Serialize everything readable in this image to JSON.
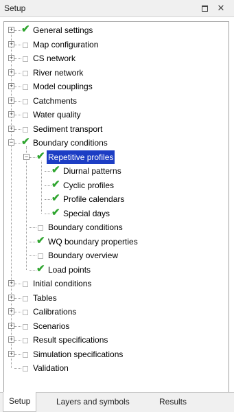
{
  "panel": {
    "title": "Setup"
  },
  "tree": [
    {
      "label": "General settings",
      "checked": true
    },
    {
      "label": "Map configuration",
      "checked": false
    },
    {
      "label": "CS network",
      "checked": false
    },
    {
      "label": "River network",
      "checked": false
    },
    {
      "label": "Model couplings",
      "checked": false
    },
    {
      "label": "Catchments",
      "checked": false
    },
    {
      "label": "Water quality",
      "checked": false
    },
    {
      "label": "Sediment transport",
      "checked": false
    },
    {
      "label": "Boundary conditions",
      "checked": true,
      "expanded": true
    },
    {
      "label": "Repetitive profiles",
      "checked": true,
      "expanded": true,
      "selected": true
    },
    {
      "label": "Diurnal patterns",
      "checked": true
    },
    {
      "label": "Cyclic profiles",
      "checked": true
    },
    {
      "label": "Profile calendars",
      "checked": true
    },
    {
      "label": "Special days",
      "checked": true
    },
    {
      "label": "Boundary conditions",
      "checked": false
    },
    {
      "label": "WQ boundary properties",
      "checked": true
    },
    {
      "label": "Boundary overview",
      "checked": false
    },
    {
      "label": "Load points",
      "checked": true
    },
    {
      "label": "Initial conditions",
      "checked": false
    },
    {
      "label": "Tables",
      "checked": false
    },
    {
      "label": "Calibrations",
      "checked": false
    },
    {
      "label": "Scenarios",
      "checked": false
    },
    {
      "label": "Result specifications",
      "checked": false
    },
    {
      "label": "Simulation specifications",
      "checked": false
    },
    {
      "label": "Validation",
      "checked": false
    }
  ],
  "tabs": [
    {
      "label": "Setup",
      "active": true
    },
    {
      "label": "Layers and symbols",
      "active": false
    },
    {
      "label": "Results",
      "active": false
    }
  ]
}
